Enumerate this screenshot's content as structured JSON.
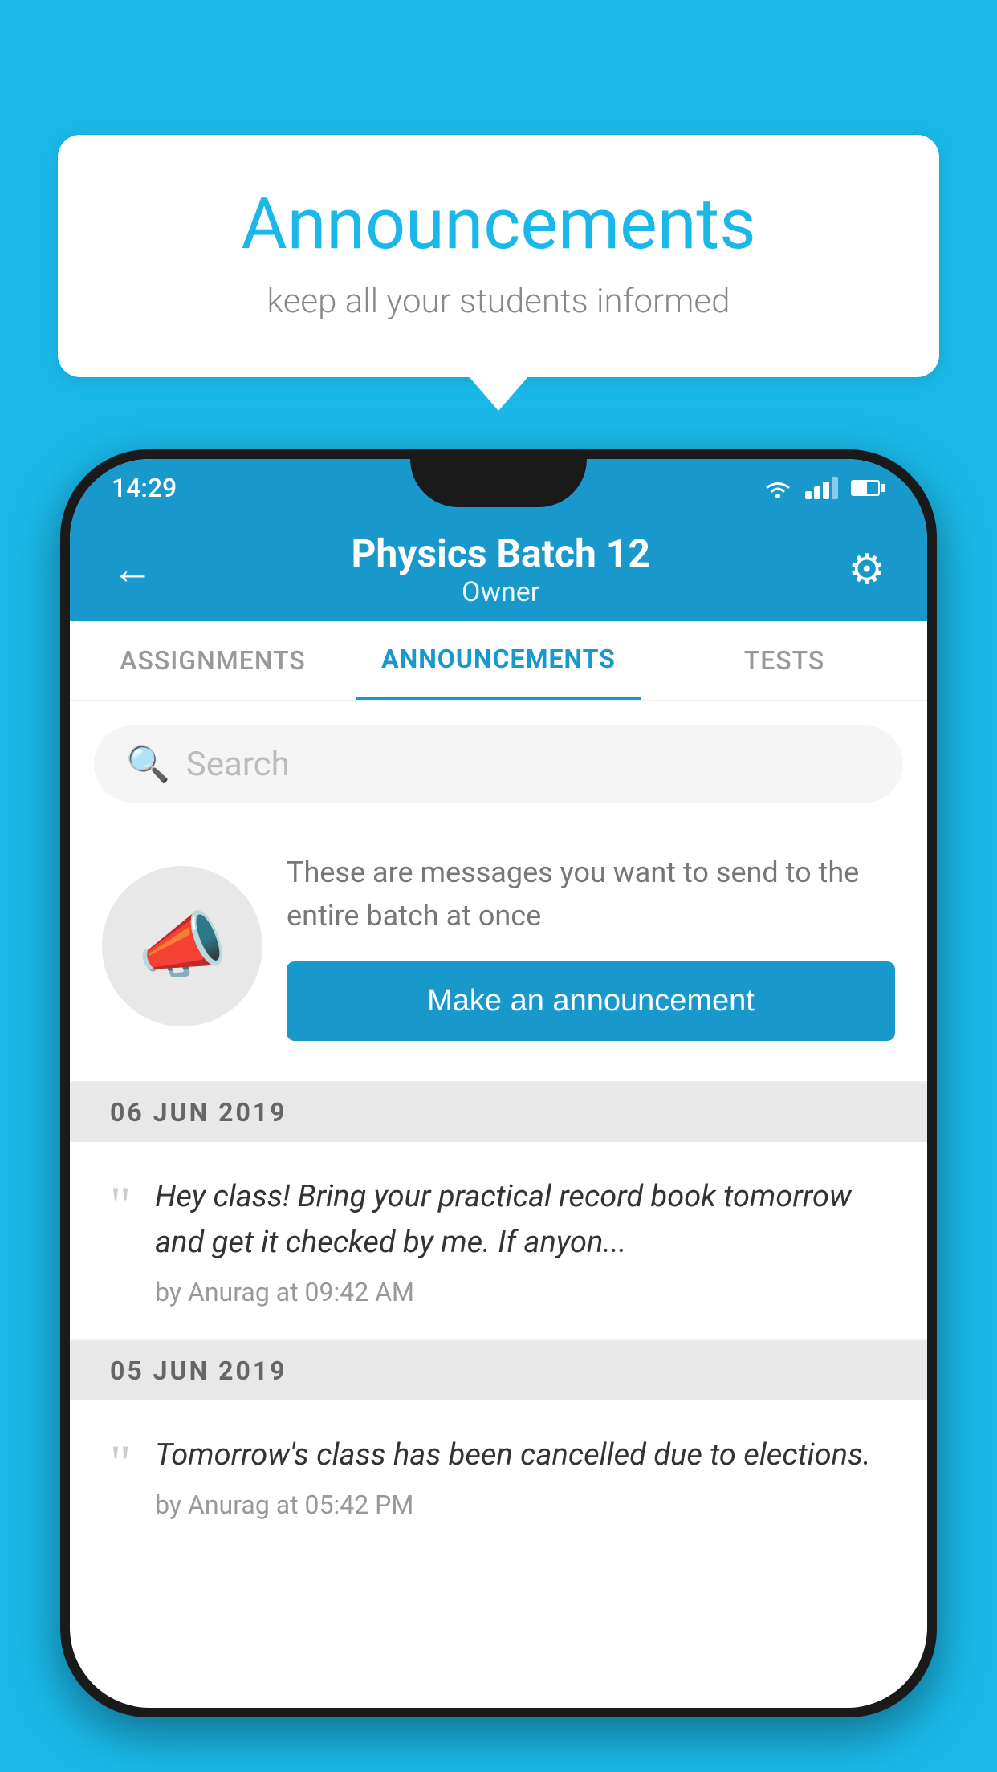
{
  "background_color": "#1ab8e8",
  "bubble": {
    "title": "Announcements",
    "subtitle": "keep all your students informed"
  },
  "status_bar": {
    "time": "14:29"
  },
  "top_bar": {
    "title": "Physics Batch 12",
    "subtitle": "Owner",
    "back_label": "←",
    "gear_label": "⚙"
  },
  "tabs": [
    {
      "label": "ASSIGNMENTS",
      "active": false
    },
    {
      "label": "ANNOUNCEMENTS",
      "active": true
    },
    {
      "label": "TESTS",
      "active": false
    }
  ],
  "search": {
    "placeholder": "Search"
  },
  "promo": {
    "description": "These are messages you want to send to the entire batch at once",
    "button_label": "Make an announcement"
  },
  "announcements": [
    {
      "date": "06  JUN  2019",
      "text": "Hey class! Bring your practical record book tomorrow and get it checked by me. If anyon...",
      "meta": "by Anurag at 09:42 AM"
    },
    {
      "date": "05  JUN  2019",
      "text": "Tomorrow's class has been cancelled due to elections.",
      "meta": "by Anurag at 05:42 PM"
    }
  ]
}
